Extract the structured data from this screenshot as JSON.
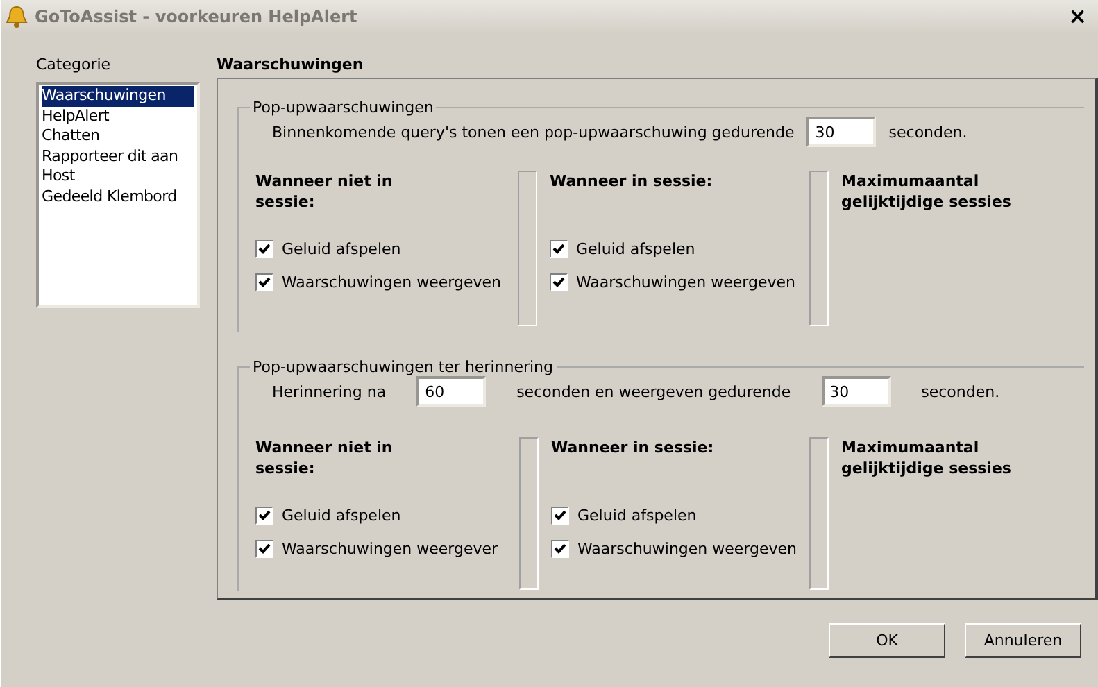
{
  "window": {
    "title": "GoToAssist - voorkeuren HelpAlert",
    "close": "×"
  },
  "categories": {
    "label": "Categorie",
    "items": [
      {
        "label": "Waarschuwingen",
        "selected": true
      },
      {
        "label": "HelpAlert",
        "selected": false
      },
      {
        "label": "Chatten",
        "selected": false
      },
      {
        "label": "Rapporteer dit aan",
        "selected": false
      },
      {
        "label": "Host",
        "selected": false
      },
      {
        "label": "Gedeeld Klembord",
        "selected": false
      }
    ]
  },
  "section_title": "Waarschuwingen",
  "groups": [
    {
      "legend": "Pop-upwaarschuwingen",
      "interval": [
        {
          "kind": "text",
          "text": "Binnenkomende query's tonen een pop-upwaarschuwing gedurende"
        },
        {
          "kind": "field",
          "value": "30"
        },
        {
          "kind": "text",
          "text": "seconden."
        }
      ],
      "columns": [
        {
          "title": "Wanneer niet in sessie:",
          "options": [
            {
              "label": "Geluid afspelen",
              "checked": true
            },
            {
              "label": "Waarschuwingen weergeven",
              "checked": true
            }
          ]
        },
        {
          "title": "Wanneer in sessie:",
          "options": [
            {
              "label": "Geluid afspelen",
              "checked": true
            },
            {
              "label": "Waarschuwingen weergeven",
              "checked": true
            }
          ]
        },
        {
          "title": "Maximumaantal gelijktijdige sessies"
        }
      ]
    },
    {
      "legend": "Pop-upwaarschuwingen ter herinnering",
      "interval": [
        {
          "kind": "text",
          "text": "Herinnering na"
        },
        {
          "kind": "field",
          "value": "60"
        },
        {
          "kind": "text",
          "text": "seconden en weergeven gedurende"
        },
        {
          "kind": "field",
          "value": "30"
        },
        {
          "kind": "text",
          "text": "seconden."
        }
      ],
      "columns": [
        {
          "title": "Wanneer niet in sessie:",
          "options": [
            {
              "label": "Geluid afspelen",
              "checked": true
            },
            {
              "label": "Waarschuwingen weergever",
              "checked": true
            }
          ]
        },
        {
          "title": "Wanneer in sessie:",
          "options": [
            {
              "label": "Geluid afspelen",
              "checked": true
            },
            {
              "label": "Waarschuwingen weergeven",
              "checked": true
            }
          ]
        },
        {
          "title": "Maximumaantal gelijktijdige sessies"
        }
      ]
    }
  ],
  "buttons": [
    "OK",
    "Annuleren"
  ]
}
